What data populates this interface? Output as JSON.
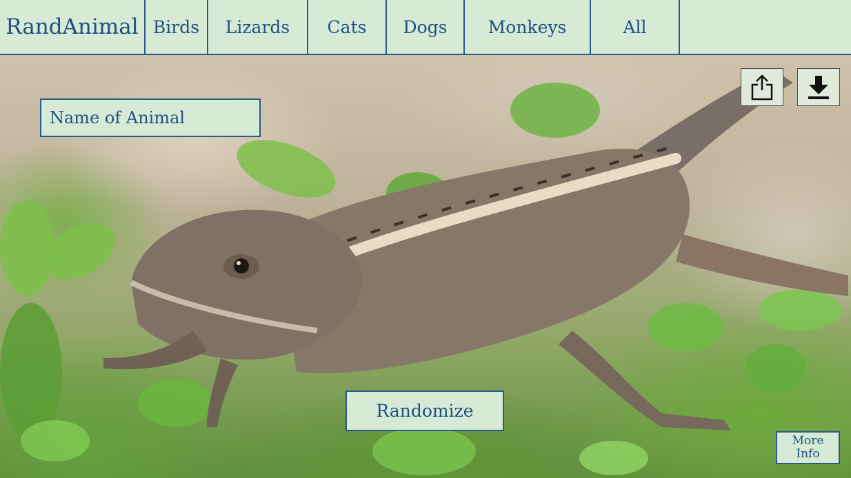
{
  "navbar": {
    "brand": "RandAnimal",
    "items": [
      {
        "label": "Birds"
      },
      {
        "label": "Lizards"
      },
      {
        "label": "Cats"
      },
      {
        "label": "Dogs"
      },
      {
        "label": "Monkeys"
      },
      {
        "label": "All"
      }
    ]
  },
  "main": {
    "animal_name": "Name of Animal",
    "randomize_label": "Randomize",
    "more_info_label": "More\nInfo",
    "share_icon": "share-icon",
    "download_icon": "download-icon",
    "background_image": "lizard-photo"
  },
  "colors": {
    "panel": "#d6ead6",
    "accent": "#1f4f83",
    "border": "#2a5a8a"
  }
}
